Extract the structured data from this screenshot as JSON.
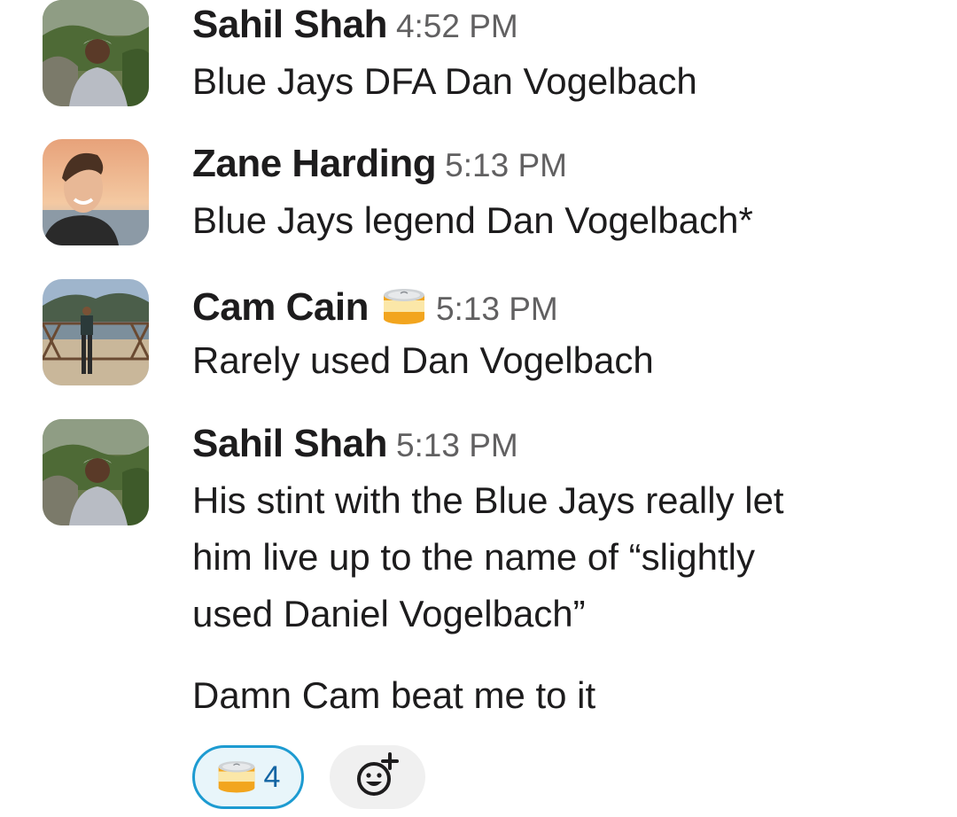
{
  "messages": [
    {
      "author": "Sahil Shah",
      "time": "4:52 PM",
      "lines": [
        "Blue Jays DFA Dan Vogelbach"
      ]
    },
    {
      "author": "Zane Harding",
      "time": "5:13 PM",
      "lines": [
        "Blue Jays legend Dan Vogelbach*"
      ]
    },
    {
      "author": "Cam Cain",
      "status_icon": "can-emoji-icon",
      "time": "5:13 PM",
      "lines": [
        "Rarely used Dan Vogelbach"
      ]
    },
    {
      "author": "Sahil Shah",
      "time": "5:13 PM",
      "lines": [
        "His stint with the Blue Jays really let",
        "him live up to the name of “slightly",
        "used Daniel Vogelbach”"
      ]
    }
  ],
  "followup": {
    "text": "Damn Cam beat me to it"
  },
  "reactions": [
    {
      "emoji": "can-emoji-icon",
      "count": "4",
      "selected": true
    }
  ],
  "add_reaction_icon": "add-reaction-icon",
  "colors": {
    "text": "#1d1c1d",
    "timestamp": "#616061",
    "reaction_border": "#1d9bd1",
    "reaction_bg": "#e8f5fa",
    "reaction_count": "#1264a3"
  }
}
